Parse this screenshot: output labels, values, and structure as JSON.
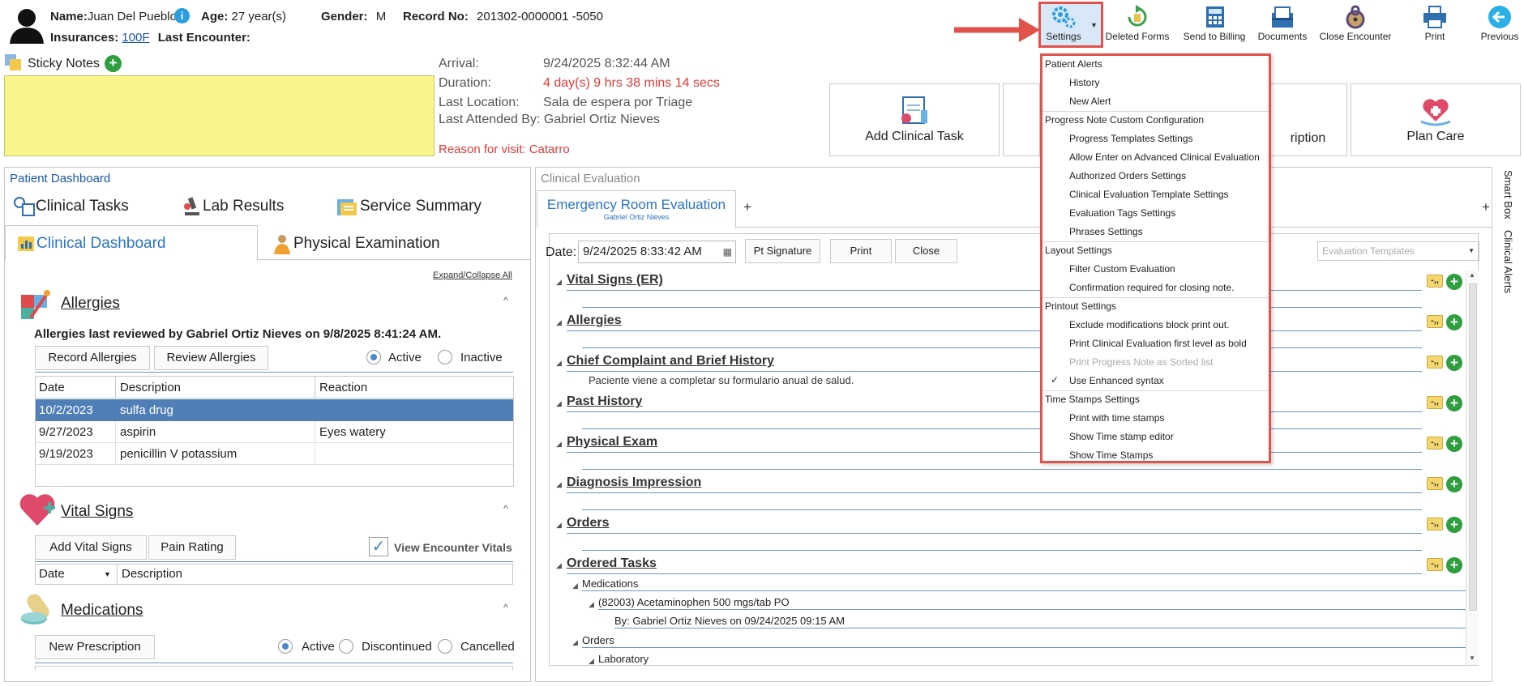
{
  "header": {
    "name_label": "Name:",
    "name_value": "Juan Del Pueblo",
    "age_label": "Age:",
    "age_value": "27 year(s)",
    "gender_label": "Gender:",
    "gender_value": "M",
    "record_label": "Record No:",
    "record_value": "201302-0000001 -5050",
    "insurances_label": "Insurances:",
    "insurances_value": "100F",
    "last_encounter_label": "Last Encounter:"
  },
  "toolbar": {
    "settings": "Settings",
    "deleted_forms": "Deleted Forms",
    "send_to_billing": "Send to Billing",
    "documents": "Documents",
    "close_encounter": "Close Encounter",
    "print": "Print",
    "previous": "Previous"
  },
  "sticky": {
    "label": "Sticky Notes"
  },
  "visit": {
    "arrival_label": "Arrival:",
    "arrival_value": "9/24/2025 8:32:44 AM",
    "duration_label": "Duration:",
    "duration_value": "4 day(s) 9 hrs 38 mins 14 secs",
    "last_location_label": "Last Location:",
    "last_location_value": "Sala de espera por Triage",
    "last_attended_label": "Last Attended By:",
    "last_attended_value": "Gabriel Ortiz Nieves",
    "reason": "Reason for visit: Catarro"
  },
  "tiles": {
    "add_clinical_task": "Add Clinical Task",
    "prescription_partial": "ription",
    "plan_care": "Plan Care"
  },
  "dashboard": {
    "title": "Patient Dashboard",
    "tabs": {
      "clinical_tasks": "Clinical Tasks",
      "lab_results": "Lab Results",
      "service_summary": "Service Summary",
      "clinical_dashboard": "Clinical Dashboard",
      "physical_examination": "Physical Examination"
    },
    "expand_collapse": "Expand/Collapse All",
    "allergies": {
      "title": "Allergies",
      "reviewed_note": "Allergies last reviewed by Gabriel Ortiz Nieves on 9/8/2025 8:41:24 AM.",
      "record_btn": "Record Allergies",
      "review_btn": "Review Allergies",
      "active": "Active",
      "inactive": "Inactive",
      "columns": {
        "date": "Date",
        "description": "Description",
        "reaction": "Reaction"
      },
      "rows": [
        {
          "date": "10/2/2023",
          "description": "sulfa drug",
          "reaction": ""
        },
        {
          "date": "9/27/2023",
          "description": "aspirin",
          "reaction": "Eyes watery"
        },
        {
          "date": "9/19/2023",
          "description": "penicillin V potassium",
          "reaction": ""
        }
      ]
    },
    "vitals": {
      "title": "Vital Signs",
      "add_btn": "Add Vital Signs",
      "pain_btn": "Pain Rating",
      "view_encounter": "View Encounter Vitals",
      "col_date": "Date",
      "col_description": "Description"
    },
    "medications": {
      "title": "Medications",
      "new_btn": "New Prescription",
      "active": "Active",
      "discontinued": "Discontinued",
      "cancelled": "Cancelled"
    }
  },
  "evaluation": {
    "header": "Clinical Evaluation",
    "tab_title": "Emergency Room Evaluation",
    "tab_sub": "Gabriel Ortiz Nieves",
    "add_tab": "+",
    "date_label": "Date:",
    "date_value": "9/24/2025 8:33:42 AM",
    "pt_signature": "Pt Signature",
    "print": "Print",
    "close": "Close",
    "templates_placeholder": "Evaluation Templates",
    "sections": [
      "Vital Signs (ER)",
      "Allergies",
      "Chief Complaint and Brief History",
      "Past History",
      "Physical Exam",
      "Diagnosis Impression",
      "Orders",
      "Ordered Tasks"
    ],
    "chief_complaint_text": "Paciente viene a completar su formulario anual de salud.",
    "ordered": {
      "medications": "Medications",
      "med_item": "(82003) Acetaminophen 500 mgs/tab PO",
      "med_by": "By: Gabriel Ortiz Nieves on 09/24/2025 09:15 AM",
      "orders": "Orders",
      "laboratory": "Laboratory"
    }
  },
  "side_tabs": {
    "smart_box": "Smart Box",
    "clinical_alerts": "Clinical Alerts"
  },
  "settings_menu": {
    "patient_alerts": "Patient Alerts",
    "history": "History",
    "new_alert": "New Alert",
    "progress_note": "Progress Note Custom Configuration",
    "progress_templates": "Progress Templates Settings",
    "allow_enter": "Allow Enter on Advanced Clinical Evaluation",
    "authorized_orders": "Authorized Orders Settings",
    "clinical_eval_template": "Clinical Evaluation Template Settings",
    "evaluation_tags": "Evaluation Tags Settings",
    "phrases": "Phrases Settings",
    "layout_settings": "Layout Settings",
    "filter_custom": "Filter Custom Evaluation",
    "confirmation_required": "Confirmation required for closing note.",
    "printout_settings": "Printout Settings",
    "exclude_modifications": "Exclude modifications block print out.",
    "print_first_level": "Print Clinical Evaluation first level as bold",
    "print_sorted": "Print Progress Note as Sorted list",
    "use_enhanced": "Use Enhanced syntax",
    "time_stamps_settings": "Time Stamps Settings",
    "print_with_ts": "Print with time stamps",
    "show_ts_editor": "Show Time stamp editor",
    "show_ts": "Show Time Stamps"
  },
  "colors": {
    "accent_blue": "#1a57a8",
    "alert_red": "#e03a3a",
    "sticky_yellow": "#f8f58a",
    "selected_row": "#4f7fb6",
    "callout_red": "#e0524a"
  }
}
